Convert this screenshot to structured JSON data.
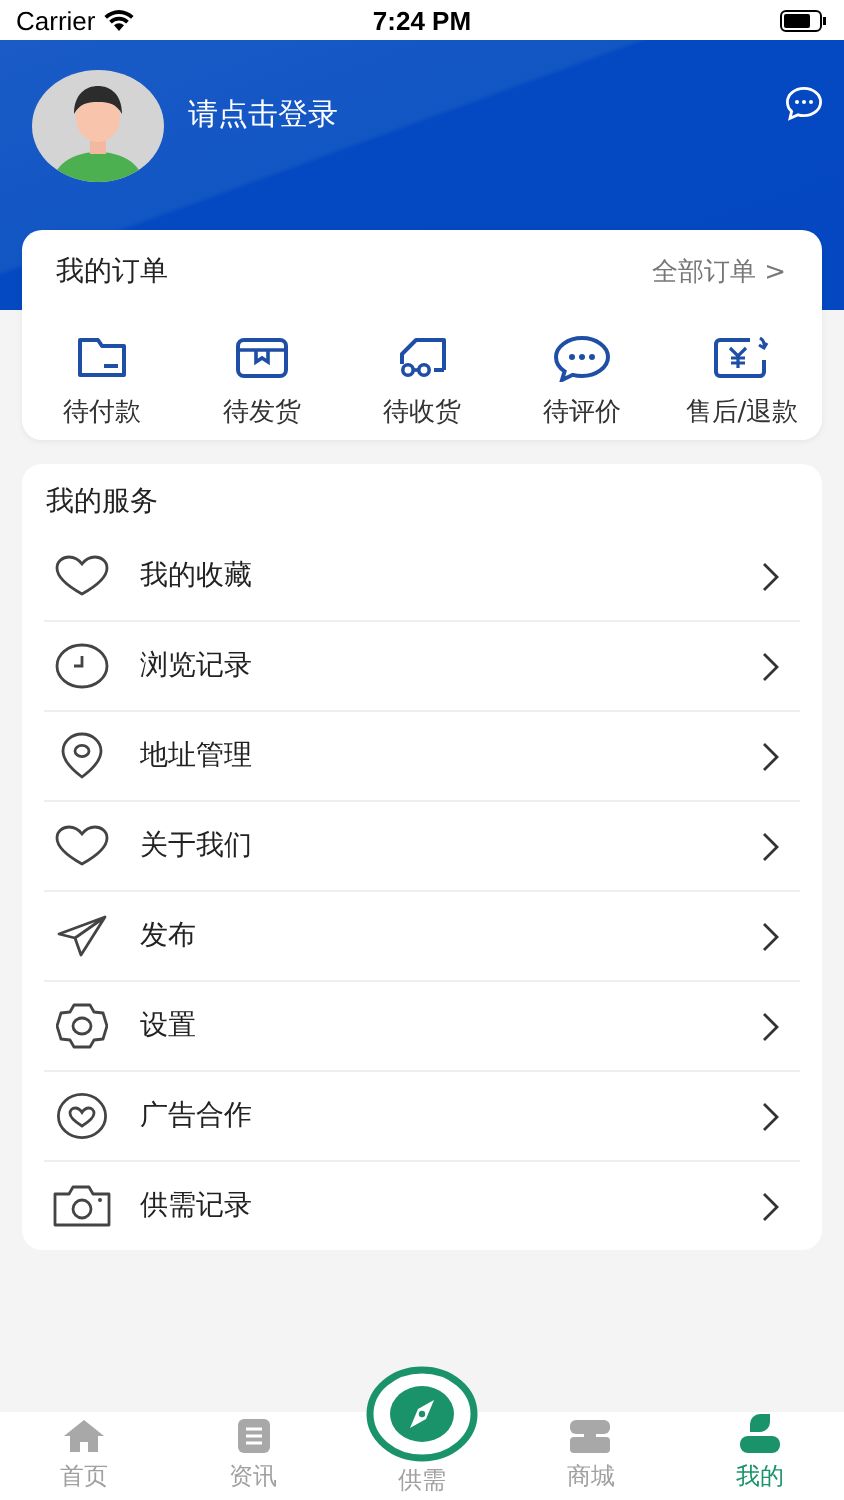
{
  "status_bar": {
    "carrier": "Carrier",
    "time": "7:24 PM"
  },
  "profile": {
    "login_prompt": "请点击登录"
  },
  "orders": {
    "title": "我的订单",
    "all_link": "全部订单 >",
    "items": [
      {
        "label": "待付款"
      },
      {
        "label": "待发货"
      },
      {
        "label": "待收货"
      },
      {
        "label": "待评价"
      },
      {
        "label": "售后/退款"
      }
    ]
  },
  "services": {
    "title": "我的服务",
    "items": [
      {
        "label": "我的收藏"
      },
      {
        "label": "浏览记录"
      },
      {
        "label": "地址管理"
      },
      {
        "label": "关于我们"
      },
      {
        "label": "发布"
      },
      {
        "label": "设置"
      },
      {
        "label": "广告合作"
      },
      {
        "label": "供需记录"
      }
    ]
  },
  "tabs": [
    {
      "label": "首页",
      "kind": "normal",
      "selected": false
    },
    {
      "label": "资讯",
      "kind": "normal",
      "selected": false
    },
    {
      "label": "供需",
      "kind": "raised",
      "selected": false
    },
    {
      "label": "商城",
      "kind": "normal",
      "selected": false
    },
    {
      "label": "我的",
      "kind": "normal",
      "selected": true
    }
  ]
}
